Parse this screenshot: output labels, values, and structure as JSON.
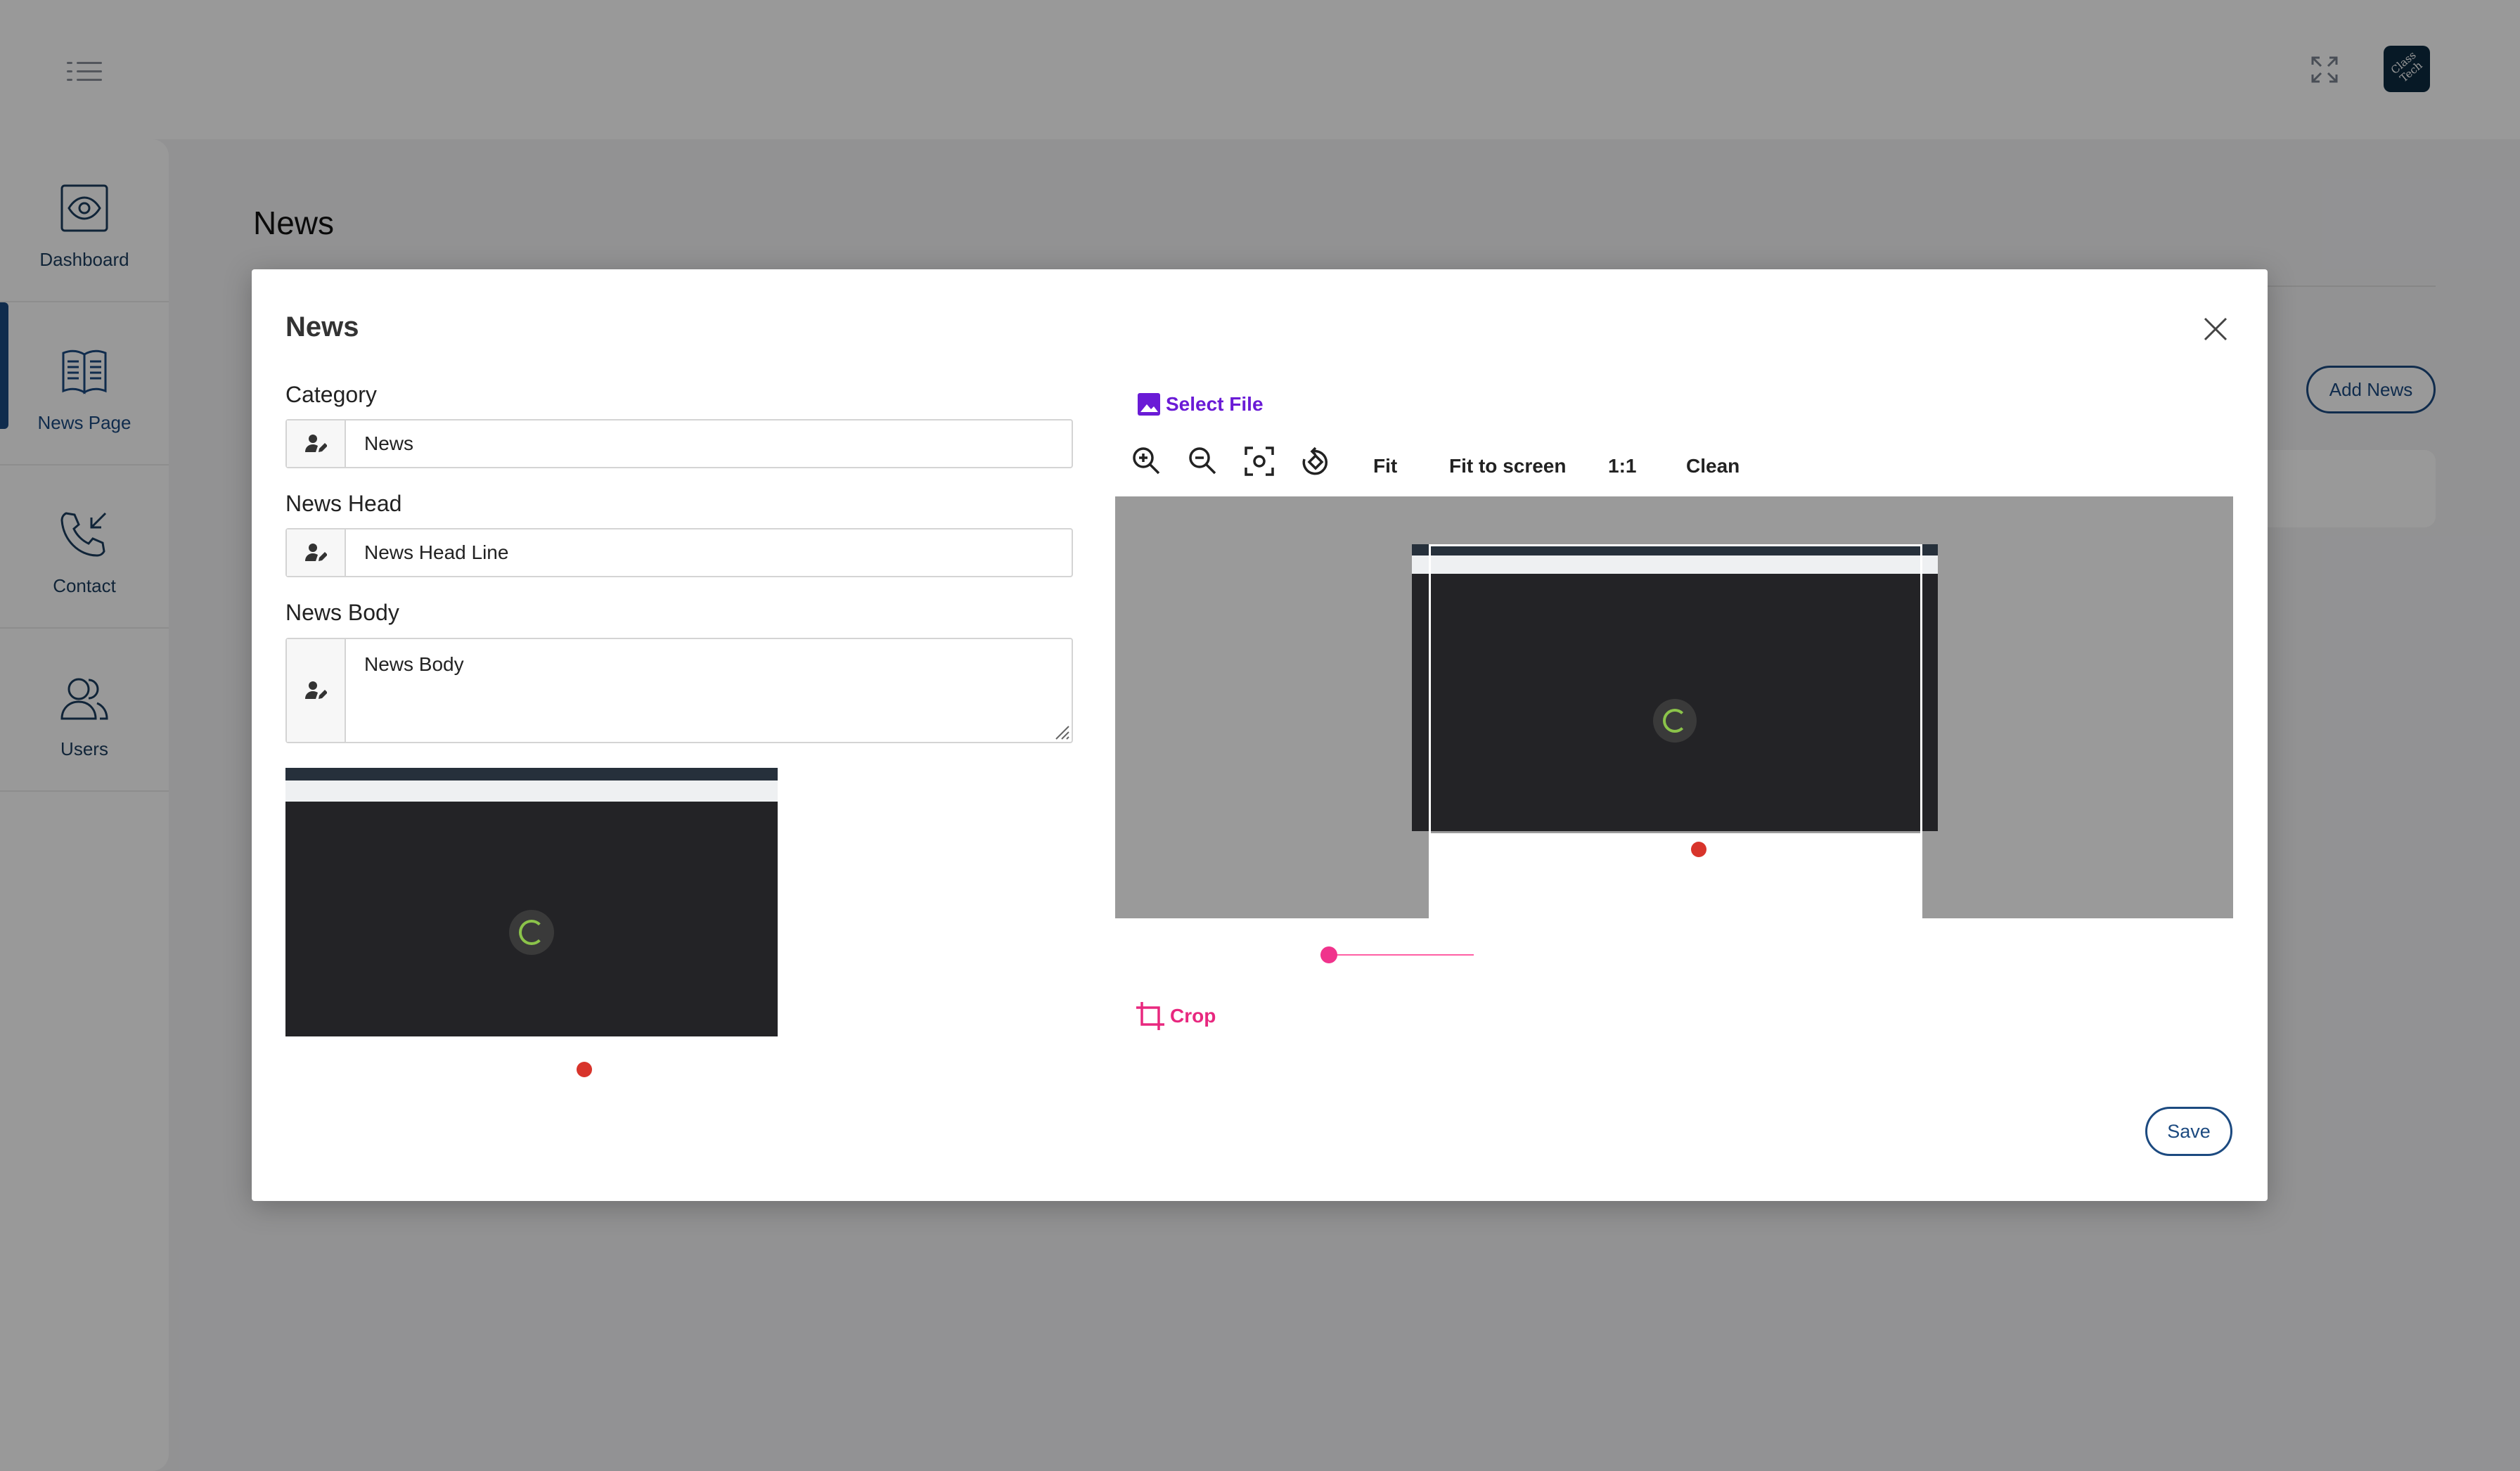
{
  "sidebar": {
    "items": [
      {
        "label": "Dashboard",
        "icon": "eye-icon"
      },
      {
        "label": "News Page",
        "icon": "book-icon",
        "active": true
      },
      {
        "label": "Contact",
        "icon": "phone-incoming-icon"
      },
      {
        "label": "Users",
        "icon": "users-icon"
      }
    ]
  },
  "header": {
    "avatar_text": "Class Tech"
  },
  "page": {
    "title": "News",
    "add_button": "Add News"
  },
  "modal": {
    "title": "News",
    "category": {
      "label": "Category",
      "value": "News"
    },
    "news_head": {
      "label": "News Head",
      "value": "News Head Line"
    },
    "news_body": {
      "label": "News Body",
      "value": "News Body"
    },
    "editor": {
      "select_file": "Select File",
      "tools": [
        "zoom-in-icon",
        "zoom-out-icon",
        "focus-icon",
        "rotate-icon"
      ],
      "fit": "Fit",
      "fit_to_screen": "Fit to screen",
      "one_to_one": "1:1",
      "clean": "Clean",
      "zoom_level": 0,
      "crop": "Crop"
    },
    "save": "Save"
  },
  "colors": {
    "accent": "#1c4a80",
    "select_file": "#6a1bd6",
    "crop": "#e8287f",
    "overlay": "rgba(0,0,0,0.40)"
  }
}
